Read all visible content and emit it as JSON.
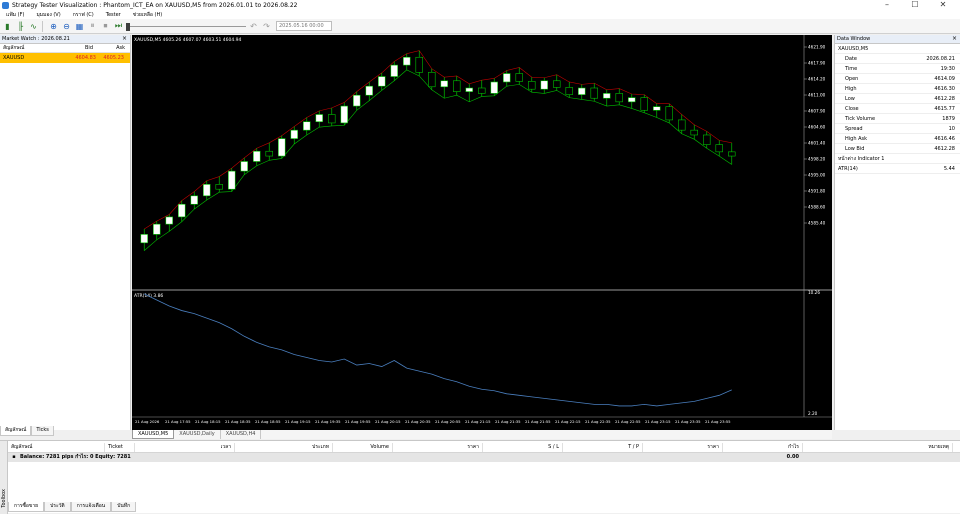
{
  "window": {
    "title": "Strategy Tester Visualization : Phantom_ICT_EA on XAUUSD,M5 from 2026.01.01 to 2026.08.22"
  },
  "menu": [
    "แฟ้ม (F)",
    "มุมมอง (V)",
    "กราฟ (C)",
    "Tester",
    "ช่วยเหลือ (H)"
  ],
  "toolbar": {
    "date_value": "2025.05.16 00:00"
  },
  "market_watch": {
    "title": "Market Watch : 2026.08.21",
    "col_symbol": "สัญลักษณ์",
    "col_bid": "Bid",
    "col_ask": "Ask",
    "rows": [
      {
        "symbol": "XAUUSD",
        "bid": "4604.83",
        "ask": "4605.23"
      }
    ],
    "tabs": [
      "สัญลักษณ์",
      "Ticks"
    ]
  },
  "chart": {
    "header": "XAUUSD,M5  4605.26 4607.07 4603.51 4604.94",
    "atr_label": "ATR(14) 3.86",
    "price_labels": [
      "4621.90",
      "4617.90",
      "4614.20",
      "4611.00",
      "4607.90",
      "4604.60",
      "4601.40",
      "4598.20",
      "4595.00",
      "4591.80",
      "4588.60",
      "4585.40"
    ],
    "atr_labels": [
      "10.26",
      "2.20"
    ],
    "time_labels": [
      "21 Aug 2026",
      "21 Aug 17:55",
      "21 Aug 18:15",
      "21 Aug 18:35",
      "21 Aug 18:55",
      "21 Aug 19:15",
      "21 Aug 19:35",
      "21 Aug 19:55",
      "21 Aug 20:15",
      "21 Aug 20:35",
      "21 Aug 20:55",
      "21 Aug 21:15",
      "21 Aug 21:35",
      "21 Aug 21:55",
      "21 Aug 22:15",
      "21 Aug 22:35",
      "21 Aug 22:55",
      "21 Aug 23:15",
      "21 Aug 23:35",
      "21 Aug 23:55"
    ],
    "tabs": [
      "XAUUSD,M5",
      "XAUUSD,Daily",
      "XAUUSD,H4"
    ],
    "colors": {
      "bull": "#ffffff",
      "bear": "#000000",
      "wick": "#00c000",
      "zigzag": "#c00000",
      "atr": "#4a7fbf"
    }
  },
  "chart_data": {
    "type": "candlestick",
    "candles": [
      [
        4590.5,
        4592.8,
        4589.2,
        4591.9
      ],
      [
        4591.9,
        4594.1,
        4591.0,
        4593.6
      ],
      [
        4593.6,
        4595.2,
        4592.4,
        4594.8
      ],
      [
        4594.8,
        4597.5,
        4594.0,
        4596.9
      ],
      [
        4596.9,
        4599.0,
        4596.1,
        4598.3
      ],
      [
        4598.3,
        4600.8,
        4597.6,
        4600.2
      ],
      [
        4600.2,
        4601.5,
        4598.9,
        4599.4
      ],
      [
        4599.4,
        4602.9,
        4599.0,
        4602.4
      ],
      [
        4602.4,
        4604.6,
        4601.8,
        4604.0
      ],
      [
        4604.0,
        4606.2,
        4603.3,
        4605.7
      ],
      [
        4605.7,
        4607.1,
        4604.2,
        4604.9
      ],
      [
        4604.9,
        4608.3,
        4604.5,
        4607.8
      ],
      [
        4607.8,
        4609.8,
        4606.9,
        4609.2
      ],
      [
        4609.2,
        4611.3,
        4608.4,
        4610.6
      ],
      [
        4610.6,
        4612.4,
        4609.7,
        4611.8
      ],
      [
        4611.8,
        4612.9,
        4609.9,
        4610.4
      ],
      [
        4610.4,
        4613.8,
        4610.0,
        4613.2
      ],
      [
        4613.2,
        4615.6,
        4612.5,
        4615.0
      ],
      [
        4615.0,
        4617.2,
        4614.1,
        4616.5
      ],
      [
        4616.5,
        4618.7,
        4615.8,
        4618.1
      ],
      [
        4618.1,
        4620.6,
        4617.4,
        4620.0
      ],
      [
        4620.0,
        4621.9,
        4619.2,
        4621.3
      ],
      [
        4621.3,
        4622.4,
        4618.2,
        4618.8
      ],
      [
        4618.8,
        4619.4,
        4615.9,
        4616.4
      ],
      [
        4616.4,
        4618.0,
        4614.5,
        4617.4
      ],
      [
        4617.4,
        4618.2,
        4615.0,
        4615.6
      ],
      [
        4615.6,
        4616.9,
        4613.9,
        4616.2
      ],
      [
        4616.2,
        4617.5,
        4614.8,
        4615.3
      ],
      [
        4615.3,
        4617.8,
        4614.9,
        4617.2
      ],
      [
        4617.2,
        4619.1,
        4616.5,
        4618.6
      ],
      [
        4618.6,
        4619.6,
        4616.8,
        4617.3
      ],
      [
        4617.3,
        4618.0,
        4615.5,
        4616.0
      ],
      [
        4616.0,
        4617.9,
        4615.3,
        4617.4
      ],
      [
        4617.4,
        4618.4,
        4615.8,
        4616.3
      ],
      [
        4616.3,
        4617.2,
        4614.6,
        4615.1
      ],
      [
        4615.1,
        4616.8,
        4614.3,
        4616.2
      ],
      [
        4616.2,
        4617.0,
        4614.0,
        4614.5
      ],
      [
        4614.5,
        4615.9,
        4613.2,
        4615.3
      ],
      [
        4615.3,
        4616.1,
        4613.4,
        4613.9
      ],
      [
        4613.9,
        4615.2,
        4612.8,
        4614.6
      ],
      [
        4614.6,
        4615.1,
        4612.1,
        4612.5
      ],
      [
        4612.5,
        4613.6,
        4611.3,
        4613.1
      ],
      [
        4613.1,
        4613.6,
        4610.4,
        4610.9
      ],
      [
        4610.9,
        4611.8,
        4608.6,
        4609.2
      ],
      [
        4609.2,
        4610.1,
        4607.7,
        4608.4
      ],
      [
        4608.4,
        4609.0,
        4606.2,
        4606.8
      ],
      [
        4606.8,
        4607.5,
        4604.9,
        4605.6
      ],
      [
        4605.6,
        4607.1,
        4603.5,
        4604.9
      ]
    ],
    "atr": [
      10.2,
      9.8,
      9.4,
      9.1,
      8.9,
      8.6,
      8.3,
      7.9,
      7.4,
      7.0,
      6.7,
      6.5,
      6.2,
      6.0,
      5.8,
      5.7,
      5.9,
      5.5,
      5.6,
      5.4,
      5.8,
      5.3,
      5.1,
      4.9,
      4.6,
      4.4,
      4.1,
      3.9,
      3.8,
      3.6,
      3.5,
      3.4,
      3.3,
      3.2,
      3.1,
      3.0,
      2.9,
      2.9,
      2.8,
      2.8,
      2.9,
      2.8,
      2.9,
      3.0,
      3.1,
      3.3,
      3.5,
      3.86
    ],
    "ylim": [
      4583.0,
      4624.0
    ],
    "atr_ylim": [
      2.2,
      10.26
    ]
  },
  "data_window": {
    "title": "Data Window",
    "symbol": "XAUUSD,M5",
    "rows": [
      {
        "k": "Date",
        "v": "2026.08.21"
      },
      {
        "k": "Time",
        "v": "19:30"
      },
      {
        "k": "Open",
        "v": "4614.09"
      },
      {
        "k": "High",
        "v": "4616.30"
      },
      {
        "k": "Low",
        "v": "4612.28"
      },
      {
        "k": "Close",
        "v": "4615.77"
      },
      {
        "k": "Tick Volume",
        "v": "1879"
      },
      {
        "k": "Spread",
        "v": "10"
      },
      {
        "k": "High Ask",
        "v": "4616.46"
      },
      {
        "k": "Low Bid",
        "v": "4612.28"
      }
    ],
    "indicator_section": "หน้าต่าง Indicator 1",
    "indicator": {
      "k": "ATR(14)",
      "v": "5.44"
    }
  },
  "toolbox": {
    "side_label": "Toolbox",
    "headers": [
      "สัญลักษณ์",
      "Ticket",
      "เวลา",
      "ประเภท",
      "Volume",
      "ราคา",
      "S / L",
      "T / P",
      "ราคา",
      "กำไร",
      "หมายเหตุ"
    ],
    "balance_text": "Balance: 7281 pips  กำไร: 0  Equity: 7281",
    "balance_profit": "0.00",
    "tabs": [
      "การซื้อขาย",
      "ประวัติ",
      "การแจ้งเตือน",
      "บันทึก"
    ]
  }
}
